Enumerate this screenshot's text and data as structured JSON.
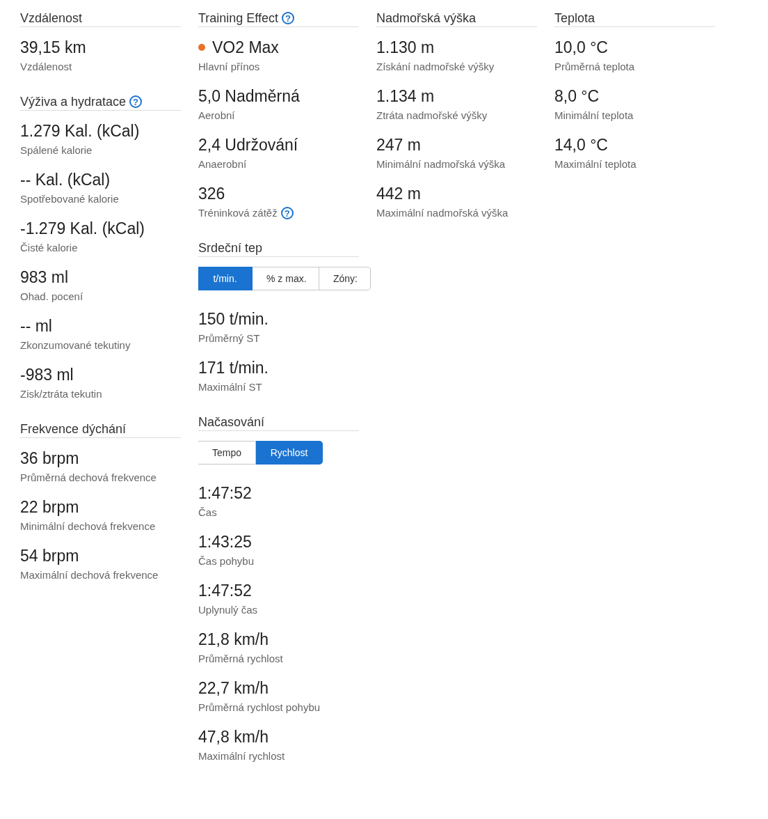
{
  "columns": [
    {
      "sections": [
        {
          "title": "Vzdálenost",
          "stats": [
            {
              "value": "39,15 km",
              "label": "Vzdálenost"
            }
          ]
        },
        {
          "title": "Výživa a hydratace",
          "help": "?",
          "stats": [
            {
              "value": "1.279 Kal. (kCal)",
              "label": "Spálené kalorie"
            },
            {
              "value": "-- Kal. (kCal)",
              "label": "Spotřebované kalorie"
            },
            {
              "value": "-1.279 Kal. (kCal)",
              "label": "Čisté kalorie"
            },
            {
              "value": "983 ml",
              "label": "Ohad. pocení"
            },
            {
              "value": "-- ml",
              "label": "Zkonzumované tekutiny"
            },
            {
              "value": "-983 ml",
              "label": "Zisk/ztráta tekutin"
            }
          ]
        },
        {
          "title": "Frekvence dýchání",
          "stats": [
            {
              "value": "36 brpm",
              "label": "Průměrná dechová frekvence"
            },
            {
              "value": "22 brpm",
              "label": "Minimální dechová frekvence"
            },
            {
              "value": "54 brpm",
              "label": "Maximální dechová frekvence"
            }
          ]
        }
      ]
    },
    {
      "sections": [
        {
          "title": "Training Effect",
          "help": "?",
          "stats": [
            {
              "value": "VO2 Max",
              "label": "Hlavní přínos",
              "color": "#e8712a"
            },
            {
              "value": "5,0 Nadměrná",
              "label": "Aerobní"
            },
            {
              "value": "2,4 Udržování",
              "label": "Anaerobní"
            },
            {
              "value": "326",
              "label": "Tréninková zátěž",
              "help": "?"
            }
          ]
        },
        {
          "title": "Srdeční tep",
          "toggle": [
            {
              "label": "t/min.",
              "selected": true
            },
            {
              "label": "% z max.",
              "selected": false
            },
            {
              "label": "Zóny:",
              "selected": false
            }
          ],
          "stats": [
            {
              "value": "150 t/min.",
              "label": "Průměrný ST"
            },
            {
              "value": "171 t/min.",
              "label": "Maximální ST"
            }
          ]
        },
        {
          "title": "Načasování",
          "toggle": [
            {
              "label": "Tempo",
              "selected": false
            },
            {
              "label": "Rychlost",
              "selected": true
            }
          ],
          "stats": [
            {
              "value": "1:47:52",
              "label": "Čas"
            },
            {
              "value": "1:43:25",
              "label": "Čas pohybu"
            },
            {
              "value": "1:47:52",
              "label": "Uplynulý čas"
            },
            {
              "value": "21,8 km/h",
              "label": "Průměrná rychlost"
            },
            {
              "value": "22,7 km/h",
              "label": "Průměrná rychlost pohybu"
            },
            {
              "value": "47,8 km/h",
              "label": "Maximální rychlost"
            }
          ]
        }
      ]
    },
    {
      "sections": [
        {
          "title": "Nadmořská výška",
          "stats": [
            {
              "value": "1.130 m",
              "label": "Získání nadmořské výšky"
            },
            {
              "value": "1.134 m",
              "label": "Ztráta nadmořské výšky"
            },
            {
              "value": "247 m",
              "label": "Minimální nadmořská výška"
            },
            {
              "value": "442 m",
              "label": "Maximální nadmořská výška"
            }
          ]
        }
      ]
    },
    {
      "sections": [
        {
          "title": "Teplota",
          "stats": [
            {
              "value": "10,0 °C",
              "label": "Průměrná teplota"
            },
            {
              "value": "8,0 °C",
              "label": "Minimální teplota"
            },
            {
              "value": "14,0 °C",
              "label": "Maximální teplota"
            }
          ]
        }
      ]
    }
  ]
}
